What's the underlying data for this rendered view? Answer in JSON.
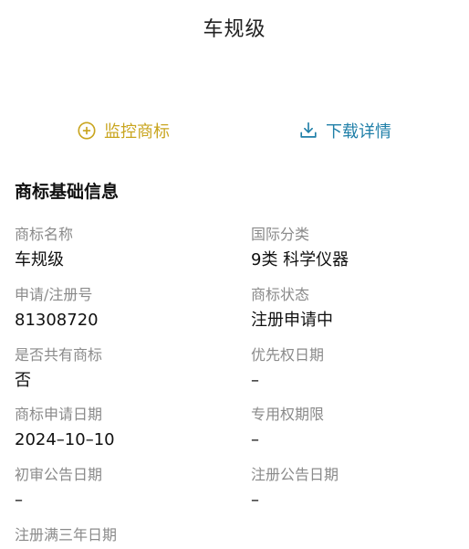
{
  "page": {
    "title": "车规级"
  },
  "actions": {
    "monitor_label": "监控商标",
    "monitor_icon": "plus-circle-icon",
    "download_label": "下载详情",
    "download_icon": "download-icon",
    "monitor_color": "#c9a51f",
    "download_color": "#1f7fa8"
  },
  "section": {
    "title": "商标基础信息"
  },
  "fields": [
    {
      "label": "商标名称",
      "value": "车规级"
    },
    {
      "label": "国际分类",
      "value": "9类 科学仪器"
    },
    {
      "label": "申请/注册号",
      "value": "81308720"
    },
    {
      "label": "商标状态",
      "value": "注册申请中"
    },
    {
      "label": "是否共有商标",
      "value": "否"
    },
    {
      "label": "优先权日期",
      "value": "–"
    },
    {
      "label": "商标申请日期",
      "value": "2024–10–10"
    },
    {
      "label": "专用权期限",
      "value": "–"
    },
    {
      "label": "初审公告日期",
      "value": "–"
    },
    {
      "label": "注册公告日期",
      "value": "–"
    },
    {
      "label": "注册满三年日期",
      "value": ""
    }
  ]
}
